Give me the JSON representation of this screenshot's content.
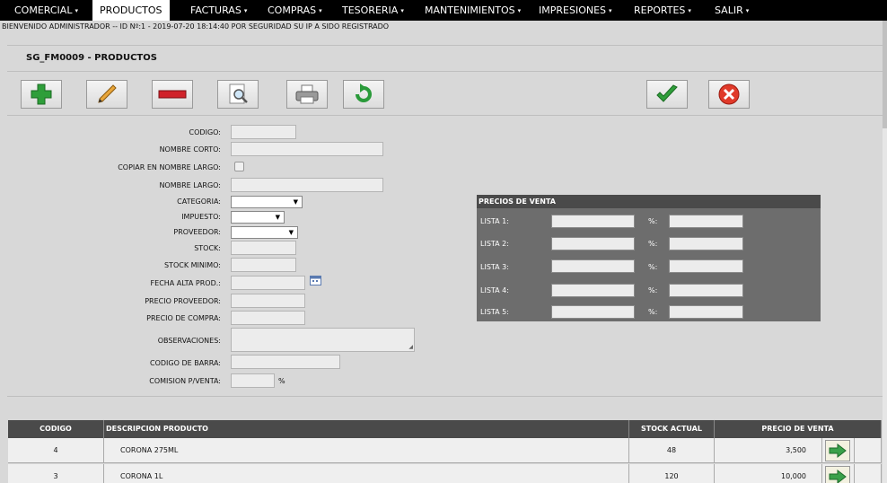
{
  "nav": {
    "items": [
      {
        "label": "COMERCIAL",
        "arrow": "▾"
      },
      {
        "label": "PRODUCTOS",
        "arrow": ""
      },
      {
        "label": "FACTURAS",
        "arrow": "▾"
      },
      {
        "label": "COMPRAS",
        "arrow": "▾"
      },
      {
        "label": "TESORERIA",
        "arrow": "▾"
      },
      {
        "label": "MANTENIMIENTOS",
        "arrow": "▾"
      },
      {
        "label": "IMPRESIONES",
        "arrow": "▾"
      },
      {
        "label": "REPORTES",
        "arrow": "▾"
      },
      {
        "label": "SALIR",
        "arrow": "▾"
      }
    ]
  },
  "welcome": "BIENVENIDO ADMINISTRADOR -- ID Nº:1 - 2019-07-20 18:14:40 POR SEGURIDAD SU IP A SIDO REGISTRADO",
  "form_title": "SG_FM0009 - PRODUCTOS",
  "toolbar": {
    "icons": [
      "add-icon",
      "edit-icon",
      "delete-icon",
      "search-icon",
      "print-icon",
      "refresh-icon",
      "accept-icon",
      "cancel-icon"
    ]
  },
  "form": {
    "codigo": "CODIGO:",
    "nombre_corto": "NOMBRE CORTO:",
    "copiar": "COPIAR EN NOMBRE LARGO:",
    "nombre_largo": "NOMBRE LARGO:",
    "categoria": "CATEGORIA:",
    "impuesto": "IMPUESTO:",
    "proveedor": "PROVEEDOR:",
    "stock": "STOCK:",
    "stock_minimo": "STOCK MINIMO:",
    "fecha_alta": "FECHA ALTA PROD.:",
    "precio_proveedor": "PRECIO PROVEEDOR:",
    "precio_compra": "PRECIO DE COMPRA:",
    "observaciones": "OBSERVACIONES:",
    "codigo_barra": "CODIGO DE BARRA:",
    "comision": "COMISION P/VENTA:",
    "comision_unit": "%"
  },
  "precios": {
    "title": "PRECIOS DE VENTA",
    "pct_label": "%:",
    "listas": [
      "LISTA 1:",
      "LISTA 2:",
      "LISTA 3:",
      "LISTA 4:",
      "LISTA 5:"
    ]
  },
  "table": {
    "headers": [
      "CODIGO",
      "DESCRIPCION PRODUCTO",
      "STOCK ACTUAL",
      "PRECIO DE VENTA"
    ],
    "rows": [
      {
        "codigo": "4",
        "descripcion": "CORONA 275ML",
        "stock": "48",
        "precio": "3,500"
      },
      {
        "codigo": "3",
        "descripcion": "CORONA 1L",
        "stock": "120",
        "precio": "10,000"
      }
    ]
  },
  "colors": {
    "nav_bg": "#000000",
    "panel_bg": "#6d6d6d",
    "header_bg": "#4a4a4a",
    "add_green": "#2e9e3a",
    "delete_red": "#d0222a",
    "accept_green": "#2f9e3a",
    "cancel_red": "#e03a2a"
  }
}
